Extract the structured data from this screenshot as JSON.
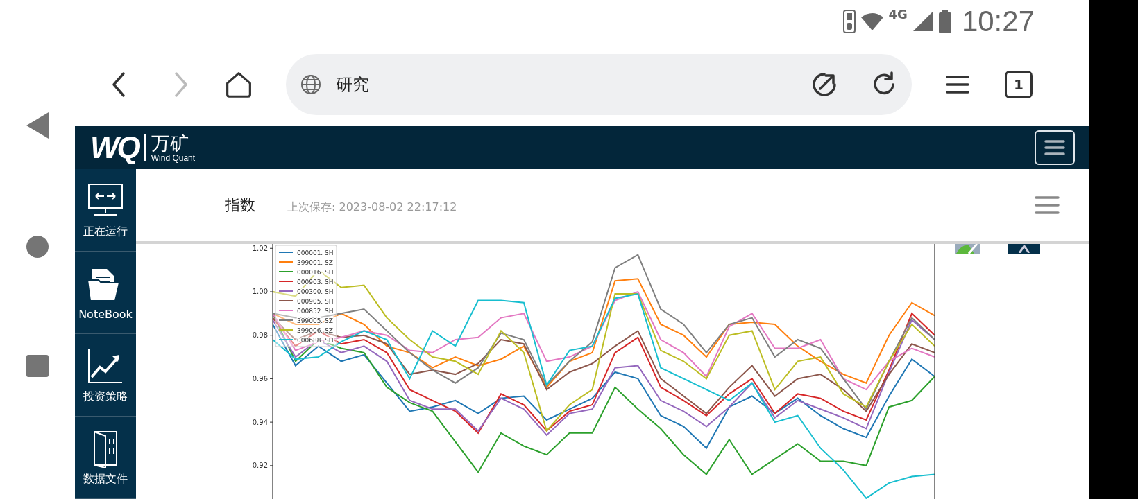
{
  "status_bar": {
    "network": "4G",
    "time": "10:27"
  },
  "browser": {
    "address": "研究",
    "tab_count": "1"
  },
  "app": {
    "logo": "WQ",
    "brand": "万矿",
    "brand_sub": "Wind Quant"
  },
  "sidebar": {
    "items": [
      {
        "label": "正在运行",
        "kind": "monitor"
      },
      {
        "label": "NoteBook",
        "kind": "folder"
      },
      {
        "label": "投资策略",
        "kind": "trend"
      },
      {
        "label": "数据文件",
        "kind": "datafile"
      }
    ]
  },
  "page": {
    "title": "指数",
    "saved": "上次保存: 2023-08-02 22:17:12",
    "chart_data": {
      "type": "line",
      "categories": [
        null,
        null,
        null,
        null,
        null,
        null,
        null,
        null,
        null,
        null,
        null,
        null,
        null,
        null,
        null,
        null,
        null,
        null,
        null,
        null,
        null,
        null,
        null,
        null,
        null,
        null,
        null,
        null,
        null,
        null
      ],
      "ylim": [
        0.904,
        1.022
      ],
      "legend": true,
      "yticks": [
        {
          "value": 0.92,
          "label": "0.92"
        },
        {
          "value": 0.94,
          "label": "0.94"
        },
        {
          "value": 0.96,
          "label": "0.96"
        },
        {
          "value": 0.98,
          "label": "0.98"
        },
        {
          "value": 1.0,
          "label": "1.00"
        },
        {
          "value": 1.02,
          "label": "1.02"
        }
      ],
      "series": [
        {
          "name": "000001. SH",
          "color": "#1f77b4",
          "values": [
            0.985,
            0.966,
            0.975,
            0.968,
            0.971,
            0.958,
            0.945,
            0.947,
            0.95,
            0.944,
            0.951,
            0.952,
            0.941,
            0.946,
            0.951,
            0.963,
            0.96,
            0.943,
            0.938,
            0.928,
            0.947,
            0.952,
            0.944,
            0.951,
            0.943,
            0.937,
            0.933,
            0.952,
            0.969,
            0.961
          ]
        },
        {
          "name": "399001. SZ",
          "color": "#ff7f0e",
          "values": [
            0.99,
            0.985,
            0.985,
            0.99,
            0.985,
            0.975,
            0.972,
            0.965,
            0.97,
            0.966,
            0.969,
            0.975,
            0.956,
            0.968,
            0.972,
            1.005,
            1.006,
            0.985,
            0.98,
            0.97,
            0.985,
            0.986,
            0.985,
            0.975,
            0.968,
            0.962,
            0.958,
            0.98,
            0.995,
            0.989
          ]
        },
        {
          "name": "000016. SH",
          "color": "#2ca02c",
          "values": [
            0.99,
            0.968,
            0.978,
            0.974,
            0.972,
            0.956,
            0.949,
            0.945,
            0.931,
            0.917,
            0.935,
            0.929,
            0.925,
            0.935,
            0.935,
            0.956,
            0.946,
            0.937,
            0.925,
            0.916,
            0.932,
            0.916,
            0.923,
            0.93,
            0.922,
            0.922,
            0.92,
            0.947,
            0.95,
            0.961
          ]
        },
        {
          "name": "000903. SH",
          "color": "#d62728",
          "values": [
            0.988,
            0.975,
            0.982,
            0.976,
            0.978,
            0.972,
            0.955,
            0.95,
            0.945,
            0.935,
            0.953,
            0.948,
            0.936,
            0.945,
            0.948,
            0.972,
            0.979,
            0.956,
            0.95,
            0.943,
            0.953,
            0.96,
            0.944,
            0.953,
            0.951,
            0.945,
            0.941,
            0.964,
            0.99,
            0.98
          ]
        },
        {
          "name": "000300. SH",
          "color": "#9467bd",
          "values": [
            0.987,
            0.97,
            0.978,
            0.972,
            0.975,
            0.968,
            0.95,
            0.946,
            0.946,
            0.936,
            0.951,
            0.946,
            0.934,
            0.944,
            0.946,
            0.965,
            0.966,
            0.95,
            0.945,
            0.938,
            0.947,
            0.958,
            0.942,
            0.95,
            0.946,
            0.942,
            0.937,
            0.963,
            0.987,
            0.978
          ]
        },
        {
          "name": "000905. SH",
          "color": "#8c564b",
          "values": [
            0.988,
            0.978,
            0.982,
            0.979,
            0.98,
            0.976,
            0.962,
            0.964,
            0.962,
            0.967,
            0.978,
            0.976,
            0.955,
            0.963,
            0.967,
            0.975,
            0.982,
            0.96,
            0.952,
            0.944,
            0.956,
            0.966,
            0.952,
            0.96,
            0.962,
            0.955,
            0.945,
            0.962,
            0.976,
            0.972
          ]
        },
        {
          "name": "000852. SH",
          "color": "#e377c2",
          "values": [
            0.99,
            0.973,
            0.977,
            0.979,
            0.982,
            0.98,
            0.973,
            0.972,
            0.978,
            0.979,
            0.988,
            0.99,
            0.968,
            0.97,
            0.975,
            0.996,
            1.0,
            0.978,
            0.972,
            0.961,
            0.984,
            0.99,
            0.974,
            0.974,
            0.978,
            0.96,
            0.955,
            0.968,
            0.974,
            0.97
          ]
        },
        {
          "name": "399005. SZ",
          "color": "#7f7f7f",
          "values": [
            0.99,
            0.988,
            0.988,
            0.99,
            0.992,
            0.982,
            0.972,
            0.964,
            0.958,
            0.965,
            0.981,
            0.978,
            0.957,
            0.968,
            0.977,
            1.011,
            1.017,
            0.992,
            0.985,
            0.972,
            0.985,
            0.988,
            0.97,
            0.978,
            0.974,
            0.96,
            0.946,
            0.968,
            0.988,
            0.978
          ]
        },
        {
          "name": "399006. SZ",
          "color": "#bcbd22",
          "values": [
            1.0,
            0.998,
            1.01,
            1.002,
            1.003,
            0.988,
            0.978,
            0.97,
            0.968,
            0.962,
            0.982,
            0.972,
            0.936,
            0.948,
            0.955,
            0.999,
            0.999,
            0.973,
            0.968,
            0.96,
            0.98,
            0.982,
            0.955,
            0.968,
            0.97,
            0.953,
            0.947,
            0.968,
            0.985,
            0.975
          ]
        },
        {
          "name": "000688. SH",
          "color": "#17becf",
          "values": [
            0.978,
            0.969,
            0.97,
            0.977,
            0.982,
            0.978,
            0.96,
            0.982,
            0.975,
            0.996,
            0.996,
            0.995,
            0.957,
            0.973,
            0.975,
            0.997,
            0.999,
            0.965,
            0.96,
            0.955,
            0.95,
            0.958,
            0.94,
            0.943,
            0.928,
            0.918,
            0.905,
            0.912,
            0.915,
            0.916
          ]
        }
      ]
    }
  }
}
